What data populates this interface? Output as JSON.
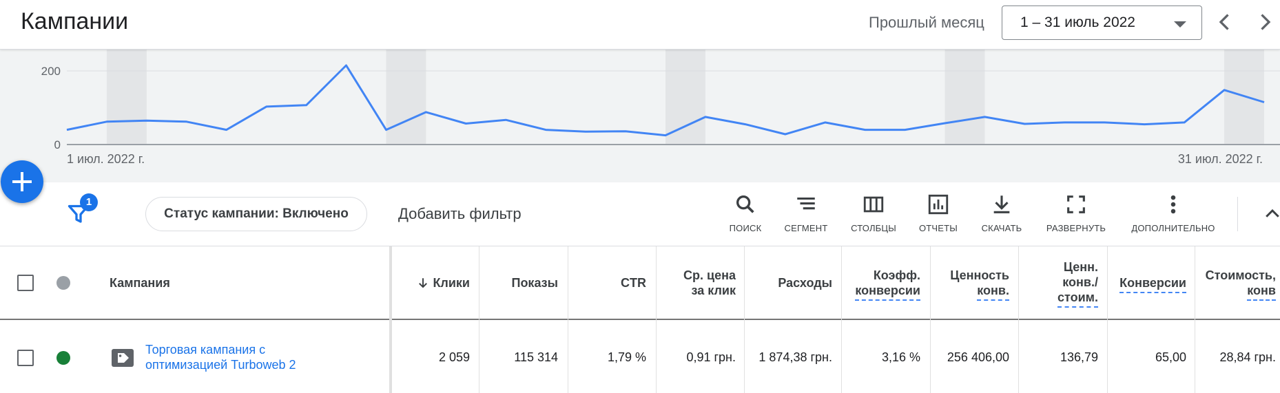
{
  "header": {
    "title": "Кампании",
    "period_label": "Прошлый месяц",
    "date_range": "1 – 31 июль 2022",
    "prev_icon": "chevron-left-icon",
    "next_icon": "chevron-right-icon"
  },
  "chart_data": {
    "type": "line",
    "y_ticks": [
      "200",
      "0"
    ],
    "ylim": [
      0,
      220
    ],
    "x_start_label": "1 июл. 2022 г.",
    "x_end_label": "31 июл. 2022 г.",
    "series": [
      {
        "color": "#4285f4",
        "values": [
          40,
          62,
          65,
          62,
          40,
          103,
          107,
          215,
          40,
          88,
          57,
          67,
          40,
          35,
          36,
          25,
          75,
          55,
          28,
          60,
          40,
          40,
          58,
          75,
          56,
          60,
          60,
          55,
          60,
          148,
          115
        ]
      }
    ],
    "weekend_bands": [
      [
        2,
        3
      ],
      [
        9,
        10
      ],
      [
        16,
        17
      ],
      [
        23,
        24
      ],
      [
        30,
        31
      ]
    ],
    "grid": true
  },
  "toolbar": {
    "add_icon": "plus-icon",
    "filter_icon": "filter-icon",
    "filter_count": "1",
    "status_chip": "Статус кампании: Включено",
    "add_filter": "Добавить фильтр",
    "tools": [
      {
        "label": "ПОИСК",
        "icon": "search-icon"
      },
      {
        "label": "СЕГМЕНТ",
        "icon": "segment-icon"
      },
      {
        "label": "СТОЛБЦЫ",
        "icon": "columns-icon"
      },
      {
        "label": "ОТЧЕТЫ",
        "icon": "reports-icon"
      },
      {
        "label": "СКАЧАТЬ",
        "icon": "download-icon"
      },
      {
        "label": "РАЗВЕРНУТЬ",
        "icon": "expand-icon"
      },
      {
        "label": "ДОПОЛНИТЕЛЬНО",
        "icon": "more-vert-icon"
      }
    ],
    "collapse_icon": "chevron-up-icon"
  },
  "table": {
    "headers": {
      "campaign": "Кампания",
      "clicks": "Клики",
      "impressions": "Показы",
      "ctr": "CTR",
      "avg_cpc_1": "Ср. цена",
      "avg_cpc_2": "за клик",
      "cost": "Расходы",
      "conv_rate_1": "Коэфф.",
      "conv_rate_2": "конверсии",
      "conv_value_1": "Ценность",
      "conv_value_2": "конв.",
      "value_cost_1": "Ценн.",
      "value_cost_2": "конв./",
      "value_cost_3": "стоим.",
      "conversions": "Конверсии",
      "cost_conv_1": "Стоимость,",
      "cost_conv_2": "конв"
    },
    "sort_icon": "arrow-down-icon",
    "header_status_color": "#9aa0a6",
    "rows": [
      {
        "status_color": "#188038",
        "icon": "tag-icon",
        "campaign_1": "Торговая кампания с",
        "campaign_2": "оптимизацией Turboweb 2",
        "clicks": "2 059",
        "impressions": "115 314",
        "ctr": "1,79 %",
        "avg_cpc": "0,91 грн.",
        "cost": "1 874,38 грн.",
        "conv_rate": "3,16 %",
        "conv_value": "256 406,00",
        "value_cost": "136,79",
        "conversions": "65,00",
        "cost_conv": "28,84 грн."
      }
    ]
  }
}
